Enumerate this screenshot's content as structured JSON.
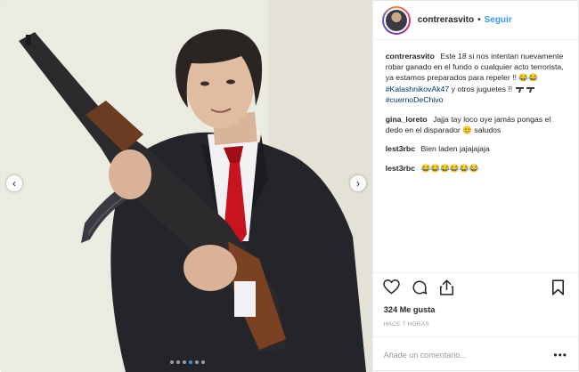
{
  "header": {
    "username": "contrerasvito",
    "separator": "•",
    "follow_label": "Seguir"
  },
  "caption": {
    "username": "contrerasvito",
    "text_1": "Este 18 si nos intentan nuevamente robar ganado en el fundo o cualquier acto terrorista, ya estamos preparados para repeler !! 😂😂",
    "hashtag_1": "#KalashnikovAk47",
    "text_2": " y otros juguetes !! ",
    "hashtag_2": "#cuernoDeChivo"
  },
  "comments": [
    {
      "username": "gina_loreto",
      "text": "Jajja tay loco oye jamás pongas el dedo en el disparador 😊 saludos"
    },
    {
      "username": "lest3rbc",
      "text": "Bien laden jajajajaja"
    },
    {
      "username": "lest3rbc",
      "text": "😂😂😂😂😂😂"
    }
  ],
  "stats": {
    "likes": "324 Me gusta",
    "time": "HACE 7 HORAS"
  },
  "comment_box": {
    "placeholder": "Añade un comentario...",
    "more_label": "•••"
  },
  "carousel": {
    "total": 6,
    "active_index": 3,
    "prev_label": "‹",
    "next_label": "›"
  },
  "colors": {
    "link_blue": "#3897f0",
    "hashtag": "#003569",
    "muted": "#999999",
    "text": "#262626"
  },
  "icons": {
    "like": "heart-icon",
    "comment": "comment-icon",
    "share": "share-icon",
    "save": "bookmark-icon",
    "gun_emoji": "pistol-emoji-icon"
  }
}
